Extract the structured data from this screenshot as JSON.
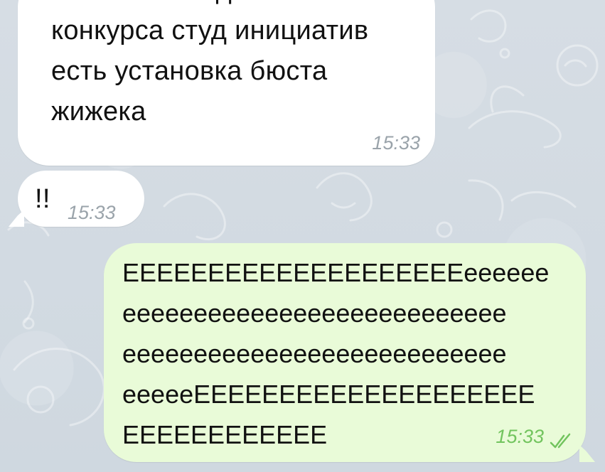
{
  "messages": [
    {
      "text": "в числе победителей\nконкурса студ инициатив\nесть установка бюста\nжижека",
      "time": "15:33"
    },
    {
      "text": "!!",
      "time": "15:33"
    },
    {
      "text": "ЕЕЕЕЕЕЕЕЕЕЕЕЕЕЕЕЕЕЕЕеееееe\nеееееееееееееееееееееееееее\nеееееееееееееееееееееееееее\nеееееЕЕЕЕЕЕЕЕЕЕЕЕЕЕЕЕЕЕЕЕ\nЕЕЕЕЕЕЕЕЕЕЕЕ",
      "time": "15:33",
      "status_icon": "double-check-icon"
    }
  ],
  "colors": {
    "chat_background": "#d5dde4",
    "incoming_bubble": "#ffffff",
    "outgoing_bubble": "#e9fbd8",
    "incoming_time": "#9aa3aa",
    "outgoing_time": "#72c45e"
  }
}
